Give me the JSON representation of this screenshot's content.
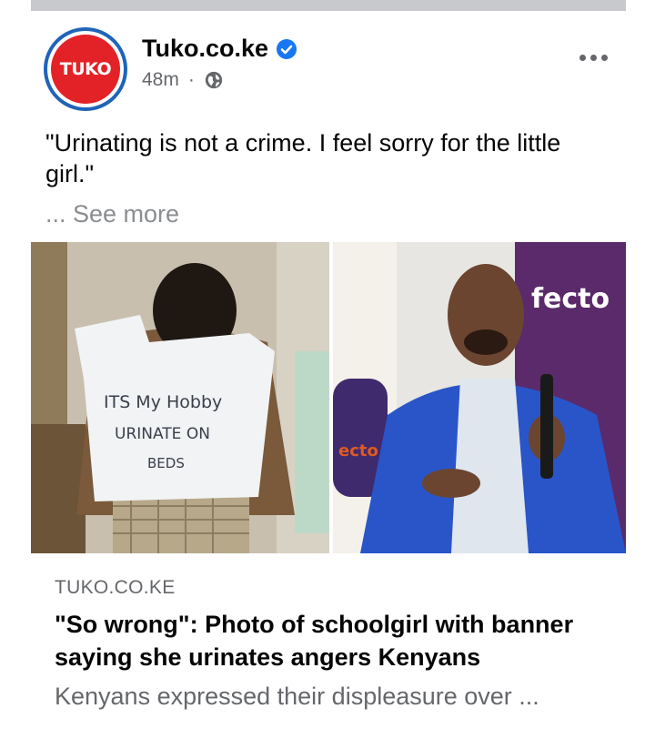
{
  "header": {
    "avatar_text": "TUKO",
    "page_name": "Tuko.co.ke",
    "time": "48m",
    "separator": "·"
  },
  "post": {
    "text": "\"Urinating is not a crime. I feel sorry for the little girl.\"",
    "see_more": "... See more"
  },
  "images": {
    "left_sign_line1": "ITS My Hobby",
    "left_sign_line2": "URINATE ON",
    "left_sign_line3": "BEDS",
    "right_banner_text": "fecto",
    "right_stand_text": "ecto"
  },
  "link_preview": {
    "domain": "TUKO.CO.KE",
    "title": "\"So wrong\": Photo of schoolgirl with banner saying she urinates angers Kenyans",
    "description": "Kenyans expressed their displeasure over ..."
  },
  "colors": {
    "brand_red": "#e32227",
    "brand_blue": "#1f64b8",
    "verified_blue": "#1877f2",
    "meta_gray": "#65676b"
  },
  "icons": {
    "verified": "verified-badge-icon",
    "globe": "globe-icon",
    "more": "more-options-icon"
  }
}
